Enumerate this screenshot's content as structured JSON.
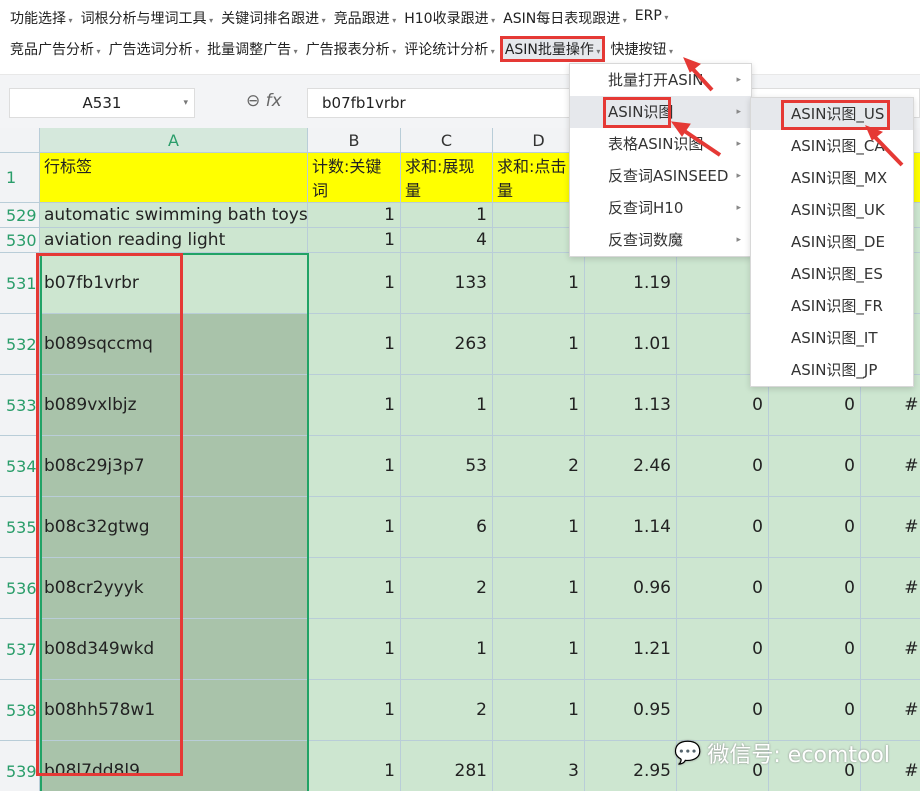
{
  "toolbar": {
    "row1": [
      "功能选择",
      "词根分析与埋词工具",
      "关键词排名跟进",
      "竞品跟进",
      "H10收录跟进",
      "ASIN每日表现跟进",
      "ERP"
    ],
    "row2": [
      "竞品广告分析",
      "广告选词分析",
      "批量调整广告",
      "广告报表分析",
      "评论统计分析",
      "ASIN批量操作",
      "快捷按钮"
    ]
  },
  "formula": {
    "cell": "A531",
    "value": "b07fb1vrbr",
    "fx": "fx"
  },
  "columns": [
    "A",
    "B",
    "C",
    "D"
  ],
  "header_row": {
    "num": "1",
    "cells": [
      "行标签",
      "计数:关键词",
      "求和:展现量",
      "求和:点击量"
    ]
  },
  "rows": [
    {
      "n": "529",
      "a": "automatic swimming bath toys",
      "v": [
        "1",
        "1",
        "",
        "",
        "",
        "",
        ""
      ]
    },
    {
      "n": "530",
      "a": "aviation reading light",
      "v": [
        "1",
        "4",
        "",
        "",
        "",
        "",
        ""
      ]
    },
    {
      "n": "531",
      "a": "b07fb1vrbr",
      "v": [
        "1",
        "133",
        "1",
        "1.19",
        "",
        "",
        ""
      ]
    },
    {
      "n": "532",
      "a": "b089sqccmq",
      "v": [
        "1",
        "263",
        "1",
        "1.01",
        "",
        "",
        ""
      ]
    },
    {
      "n": "533",
      "a": "b089vxlbjz",
      "v": [
        "1",
        "1",
        "1",
        "1.13",
        "0",
        "0",
        "#DIV/"
      ]
    },
    {
      "n": "534",
      "a": "b08c29j3p7",
      "v": [
        "1",
        "53",
        "2",
        "2.46",
        "0",
        "0",
        "#DIV/"
      ]
    },
    {
      "n": "535",
      "a": "b08c32gtwg",
      "v": [
        "1",
        "6",
        "1",
        "1.14",
        "0",
        "0",
        "#DIV/"
      ]
    },
    {
      "n": "536",
      "a": "b08cr2yyyk",
      "v": [
        "1",
        "2",
        "1",
        "0.96",
        "0",
        "0",
        "#DIV/"
      ]
    },
    {
      "n": "537",
      "a": "b08d349wkd",
      "v": [
        "1",
        "1",
        "1",
        "1.21",
        "0",
        "0",
        "#DIV/"
      ]
    },
    {
      "n": "538",
      "a": "b08hh578w1",
      "v": [
        "1",
        "2",
        "1",
        "0.95",
        "0",
        "0",
        "#DIV/"
      ]
    },
    {
      "n": "539",
      "a": "b08l7dd8l9",
      "v": [
        "1",
        "281",
        "3",
        "2.95",
        "0",
        "0",
        "#DIV/"
      ]
    }
  ],
  "menu": [
    "批量打开ASIN",
    "ASIN识图",
    "表格ASIN识图",
    "反查词ASINSEED",
    "反查词H10",
    "反查词数魔"
  ],
  "submenu": [
    "ASIN识图_US",
    "ASIN识图_CA",
    "ASIN识图_MX",
    "ASIN识图_UK",
    "ASIN识图_DE",
    "ASIN识图_ES",
    "ASIN识图_FR",
    "ASIN识图_IT",
    "ASIN识图_JP"
  ],
  "watermark": "微信号: ecomtool"
}
